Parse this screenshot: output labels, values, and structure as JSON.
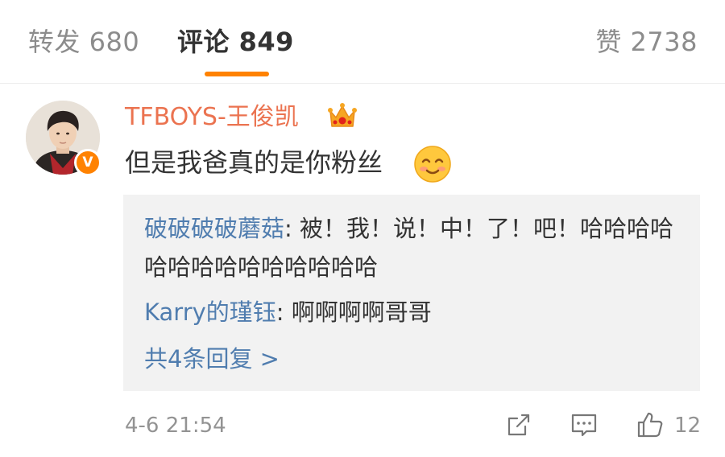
{
  "tabs": {
    "repost": "转发 680",
    "comments": "评论 849",
    "likes": "赞 2738"
  },
  "colors": {
    "accent": "#ff8200",
    "username": "#eb7350",
    "link": "#507daf"
  },
  "comment": {
    "user": "TFBOYS-王俊凯",
    "text": "但是我爸真的是你粉丝",
    "verified_badge": "V",
    "timestamp": "4-6 21:54",
    "like_count": "12",
    "replies": [
      {
        "user": "破破破破蘑菇",
        "sep": ": ",
        "text": "被！我！说！中！了！吧！哈哈哈哈哈哈哈哈哈哈哈哈哈哈"
      },
      {
        "user": "Karry的瑾钰",
        "sep": ": ",
        "text": "啊啊啊啊哥哥"
      }
    ],
    "more_replies": "共4条回复 >"
  },
  "icons": [
    "crown-icon",
    "smile-emoji-icon",
    "share-icon",
    "comment-icon",
    "like-icon",
    "verified-badge"
  ]
}
